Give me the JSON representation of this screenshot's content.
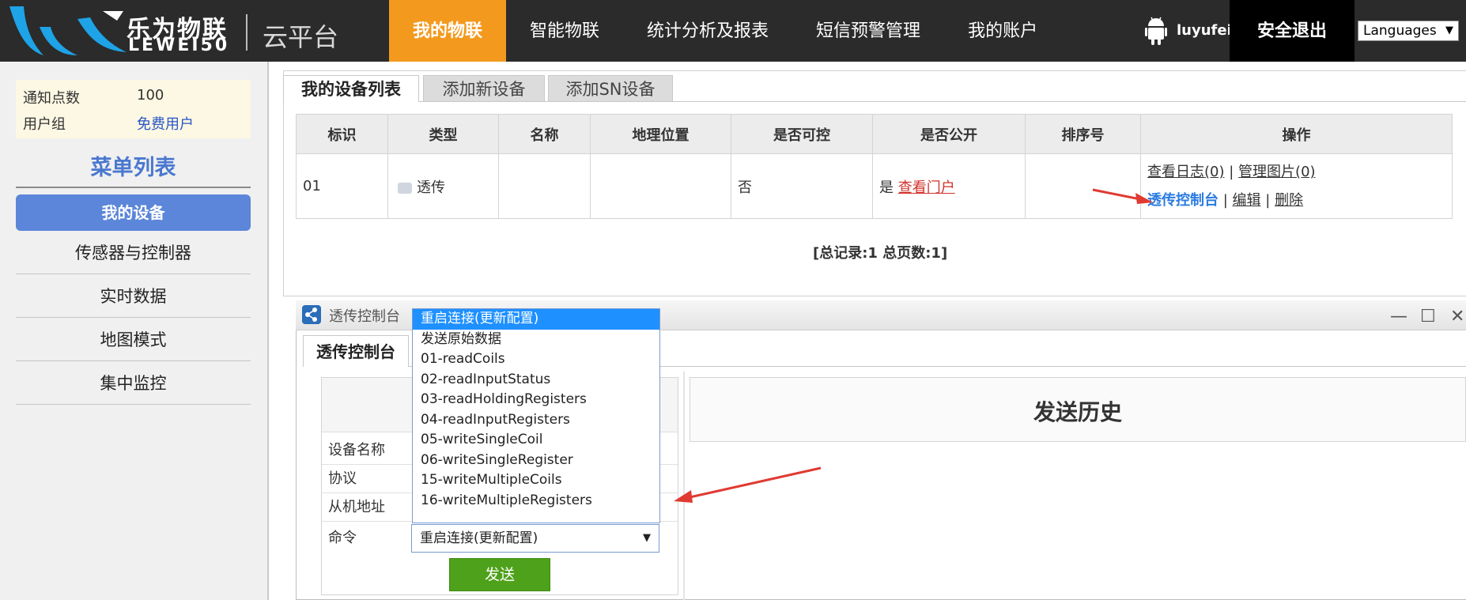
{
  "header": {
    "logo_cn": "乐为物联",
    "logo_en": "LEWEI50",
    "logo_sub": "云平台",
    "nav": [
      "我的物联",
      "智能物联",
      "统计分析及报表",
      "短信预警管理",
      "我的账户"
    ],
    "active_nav": 0,
    "username": "luyufei",
    "logout": "安全退出",
    "language": "Languages"
  },
  "sidebar": {
    "notice_label": "通知点数",
    "notice_value": "100",
    "group_label": "用户组",
    "group_value": "免费用户",
    "menu_title": "菜单列表",
    "items": [
      "我的设备",
      "传感器与控制器",
      "实时数据",
      "地图模式",
      "集中监控"
    ]
  },
  "tabs": [
    "我的设备列表",
    "添加新设备",
    "添加SN设备"
  ],
  "table": {
    "headers": [
      "标识",
      "类型",
      "名称",
      "地理位置",
      "是否可控",
      "是否公开",
      "排序号",
      "操作"
    ],
    "row": {
      "id": "01",
      "type": "透传",
      "name": "",
      "location": "",
      "controllable": "否",
      "public": "是",
      "public_link": "查看门户",
      "sort": "",
      "ops_log": "查看日志(0)",
      "ops_img": "管理图片(0)",
      "ops_console": "透传控制台",
      "ops_edit": "编辑",
      "ops_delete": "删除",
      "sep": "|"
    },
    "summary": "[总记录:1 总页数:1]"
  },
  "console": {
    "window_title": "透传控制台",
    "tab": "透传控制台",
    "fields": [
      "设备名称",
      "协议",
      "从机地址",
      "命令"
    ],
    "selected_command": "重启连接(更新配置)",
    "options": [
      "重启连接(更新配置)",
      "发送原始数据",
      "01-readCoils",
      "02-readInputStatus",
      "03-readHoldingRegisters",
      "04-readInputRegisters",
      "05-writeSingleCoil",
      "06-writeSingleRegister",
      "15-writeMultipleCoils",
      "16-writeMultipleRegisters"
    ],
    "send": "发送",
    "history_title": "发送历史"
  },
  "colors": {
    "header_bg": "#2b2b2b",
    "nav_active": "#f39a1e",
    "menu_active": "#5b86d9",
    "send_button": "#4ea11a",
    "link_red": "#d0322b",
    "link_blue": "#2a7be0",
    "dropdown_selected": "#1e90ff"
  }
}
